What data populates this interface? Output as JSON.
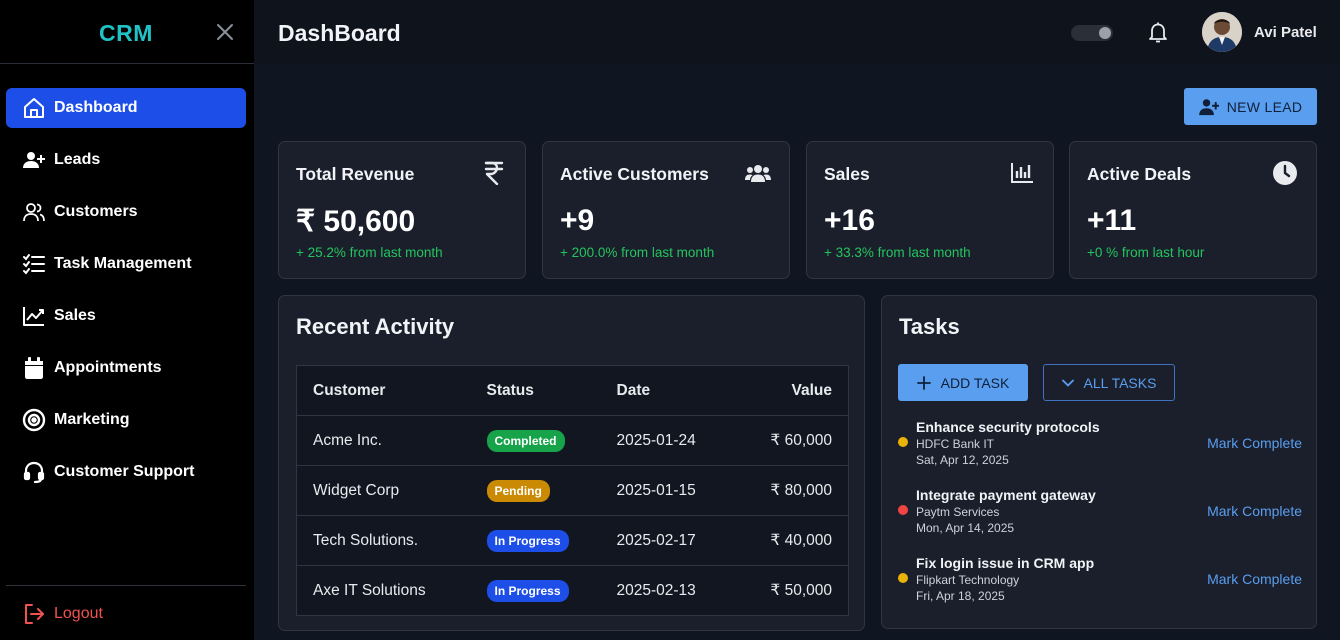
{
  "sidebar": {
    "brand": "CRM",
    "items": [
      {
        "label": "Dashboard",
        "icon": "home-icon"
      },
      {
        "label": "Leads",
        "icon": "user-plus-icon"
      },
      {
        "label": "Customers",
        "icon": "users-icon"
      },
      {
        "label": "Task Management",
        "icon": "checklist-icon"
      },
      {
        "label": "Sales",
        "icon": "chart-line-icon"
      },
      {
        "label": "Appointments",
        "icon": "calendar-icon"
      },
      {
        "label": "Marketing",
        "icon": "target-icon"
      },
      {
        "label": "Customer Support",
        "icon": "headset-icon"
      }
    ],
    "logout": "Logout"
  },
  "header": {
    "title": "DashBoard",
    "username": "Avi Patel"
  },
  "new_lead": "NEW LEAD",
  "stats": [
    {
      "title": "Total Revenue",
      "value": "₹ 50,600",
      "sub": "+ 25.2% from last month",
      "icon": "rupee-icon"
    },
    {
      "title": "Active Customers",
      "value": "+9",
      "sub": "+ 200.0% from last month",
      "icon": "users-group-icon"
    },
    {
      "title": "Sales",
      "value": "+16",
      "sub": "+ 33.3% from last month",
      "icon": "bar-chart-icon"
    },
    {
      "title": "Active Deals",
      "value": "+11",
      "sub": "+0 % from last hour",
      "icon": "clock-icon"
    }
  ],
  "activity": {
    "title": "Recent Activity",
    "columns": [
      "Customer",
      "Status",
      "Date",
      "Value"
    ],
    "rows": [
      {
        "customer": "Acme Inc.",
        "status": "Completed",
        "date": "2025-01-24",
        "value": "₹ 60,000"
      },
      {
        "customer": "Widget Corp",
        "status": "Pending",
        "date": "2025-01-15",
        "value": "₹ 80,000"
      },
      {
        "customer": "Tech Solutions.",
        "status": "In Progress",
        "date": "2025-02-17",
        "value": "₹ 40,000"
      },
      {
        "customer": "Axe IT Solutions",
        "status": "In Progress",
        "date": "2025-02-13",
        "value": "₹ 50,000"
      }
    ]
  },
  "status_colors": {
    "Completed": "#16a34a",
    "Pending": "#ca8a04",
    "In Progress": "#1d4fe8"
  },
  "tasks": {
    "title": "Tasks",
    "add_label": "ADD TASK",
    "all_label": "ALL TASKS",
    "items": [
      {
        "title": "Enhance security protocols",
        "company": "HDFC Bank IT",
        "date": "Sat, Apr 12, 2025",
        "dot": "#eab308",
        "action": "Mark Complete"
      },
      {
        "title": "Integrate payment gateway",
        "company": "Paytm Services",
        "date": "Mon, Apr 14, 2025",
        "dot": "#ef4444",
        "action": "Mark Complete"
      },
      {
        "title": "Fix login issue in CRM app",
        "company": "Flipkart Technology",
        "date": "Fri, Apr 18, 2025",
        "dot": "#eab308",
        "action": "Mark Complete"
      }
    ]
  }
}
